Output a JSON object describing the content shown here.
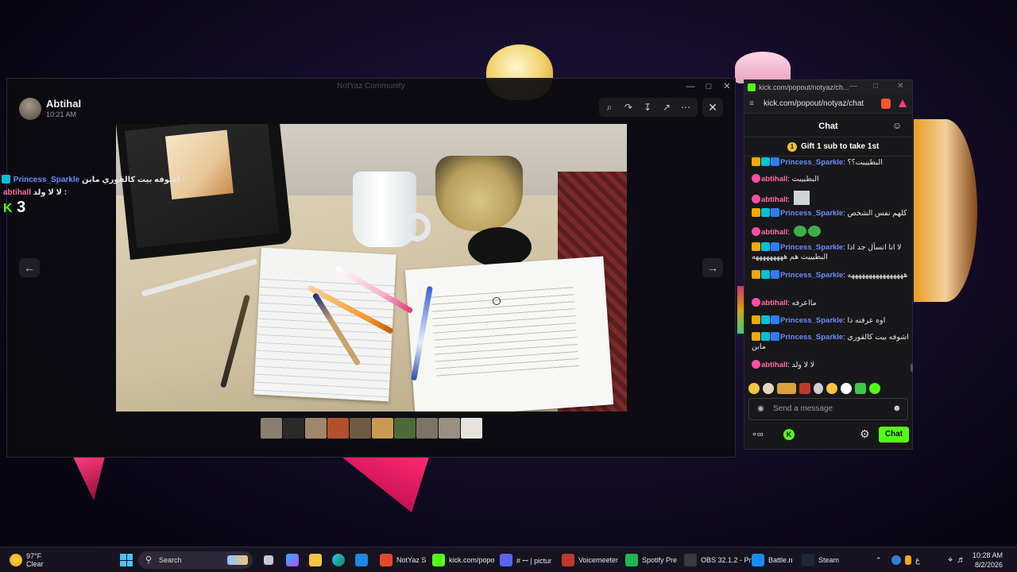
{
  "discord_viewer": {
    "window_title": "NotYaz Community",
    "author": "Abtihal",
    "time": "10:21 AM"
  },
  "overlay": {
    "line1_name": "Princess_Sparkle",
    "line1_text": "اشوفه بيت كالقوري مابن :",
    "line2_name": "abtihall",
    "line2_text": "لا لا ولد :",
    "counter": "3"
  },
  "kick": {
    "tab_title": "kick.com/popout/notyaz/ch...",
    "url": "kick.com/popout/notyaz/chat",
    "header": "Chat",
    "gift_banner": "Gift 1 sub to take 1st",
    "gift_rank": "1",
    "messages": [
      {
        "user": "Princess_Sparkle",
        "type": "ps",
        "text": "البطيييت؟؟"
      },
      {
        "user": "abtihall",
        "type": "ab",
        "text": "البطيييت"
      },
      {
        "user": "abtihall",
        "type": "ab",
        "text": "",
        "emote": "image"
      },
      {
        "user": "Princess_Sparkle",
        "type": "ps",
        "text": "كلهم نفس الشخص"
      },
      {
        "user": "abtihall",
        "type": "ab",
        "text": "",
        "emote": "frogs"
      },
      {
        "user": "Princess_Sparkle",
        "type": "ps",
        "text": "لا انا اتسأل جد اذا البطيييت هم هههههههههه"
      },
      {
        "user": "Princess_Sparkle",
        "type": "ps",
        "text": "ههههههههههههههههه"
      },
      {
        "user": "abtihall",
        "type": "ab",
        "text": "مااعرفه"
      },
      {
        "user": "Princess_Sparkle",
        "type": "ps",
        "text": "اوه عرفته ذا"
      },
      {
        "user": "Princess_Sparkle",
        "type": "ps",
        "text": "اشوفه بيت كالقوري مابن"
      },
      {
        "user": "abtihall",
        "type": "ab",
        "text": "لا لا ولد"
      }
    ],
    "input_placeholder": "Send a message",
    "chat_button": "Chat"
  },
  "taskbar": {
    "weather_temp": "97°F",
    "weather_desc": "Clear",
    "search_label": "Search",
    "apps": [
      {
        "label": "NotYaz S",
        "color": "#e3472c"
      },
      {
        "label": "kick.com/popo",
        "color": "#53fc18"
      },
      {
        "label": "# ꟷ | pictur",
        "color": "#5865f2"
      },
      {
        "label": "Voicemeeter",
        "color": "#c0392b"
      },
      {
        "label": "Spotify Pre",
        "color": "#1db954"
      },
      {
        "label": "OBS 32.1.2 - Pr",
        "color": "#3a3a3a"
      },
      {
        "label": "Battle.n",
        "color": "#148eff"
      },
      {
        "label": "Steam",
        "color": "#1b2838"
      }
    ],
    "lang": "ع",
    "time": "10:28 AM",
    "date": "8/2/2026"
  }
}
